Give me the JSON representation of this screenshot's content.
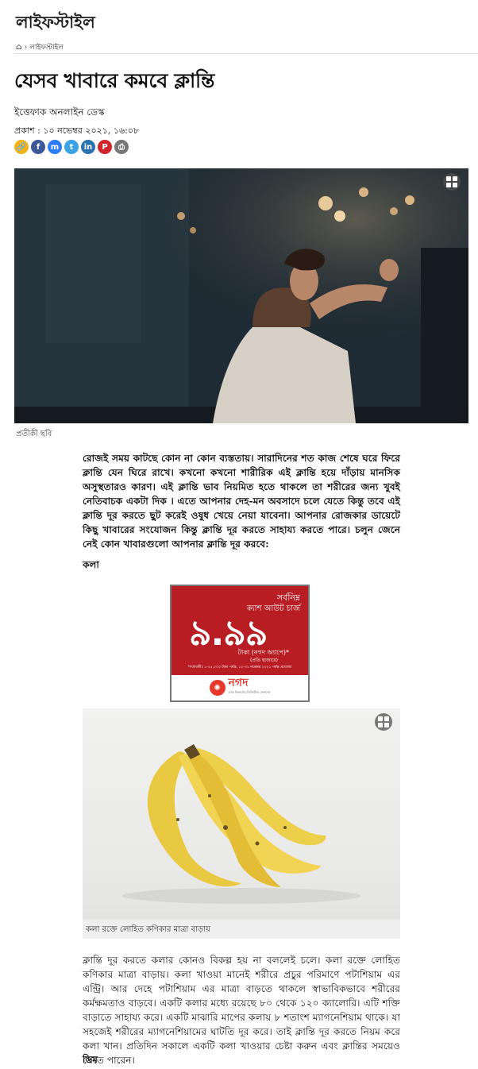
{
  "section": {
    "title": "লাইফস্টাইল"
  },
  "breadcrumb": {
    "home_icon": "home-icon",
    "separator": "›",
    "current": "লাইফস্টাইল"
  },
  "article": {
    "title": "যেসব খাবারে কমবে ক্লান্তি",
    "author": "ইত্তেফাক অনলাইন ডেস্ক",
    "published": "প্রকাশ : ১০ নভেম্বর ২০২১, ১৬:০৮",
    "share_buttons": [
      {
        "name": "copy-link-icon",
        "glyph": "🔗",
        "color": "#f2b31a"
      },
      {
        "name": "facebook-icon",
        "glyph": "f",
        "color": "#3b5998"
      },
      {
        "name": "messenger-icon",
        "glyph": "m",
        "color": "#2c7cf6"
      },
      {
        "name": "twitter-icon",
        "glyph": "t",
        "color": "#39a3e6"
      },
      {
        "name": "linkedin-icon",
        "glyph": "in",
        "color": "#2b73b0"
      },
      {
        "name": "pinterest-icon",
        "glyph": "P",
        "color": "#d1252b"
      },
      {
        "name": "print-icon",
        "glyph": "⎙",
        "color": "#777777"
      }
    ],
    "hero_caption": "প্রতীকী ছবি",
    "intro": "রোজই সময় কাটছে কোন না কোন ব্যস্ততায়। সারাদিনের শত কাজ শেষে ঘরে ফিরে ক্লান্তি যেন ঘিরে রাখে। কখনো কখনো শারীরিক এই ক্লান্তি হয়ে দাঁড়ায় মানসিক অসুস্থতারও কারণ। এই ক্লান্তি ভাব নিয়মিত হতে থাকলে তা শরীরের জন্য খুবই নেতিবাচক একটা দিক । এতে আপনার দেহ-মন অবসাদে চলে যেতে কিন্তু তবে এই ক্লান্তি দূর করতে ছুট করেই ওষুধ খেয়ে নেয়া যাবেনা। আপনার রোজকার ডায়েটে কিছু খাবারের সংযোজন কিন্তু ক্লান্তি দূর করতে সাহায্য করতে পারে। চলুন জেনে নেই কোন খাবারগুলো আপনার ক্লান্তি দূর করবে:",
    "subheading_1": "কলা",
    "banana_caption": "কলা রক্তে লোহিত কণিকার মাত্রা বাড়ায়",
    "banana_paragraph": "ক্লান্তি দূর করতে কলার কোনও বিকল্প হয় না বললেই চলে। কলা রক্তে লোহিত কণিকার মাত্রা বাড়ায়। কলা খাওয়া মানেই শরীরে প্রচুর পরিমাণে পটাশিয়াম এর এন্ট্রি। আর দেহে পটাশিয়াম এর মাত্রা বাড়তে থাকলে স্বাভাবিকভাবে শরীরের কর্মক্ষমতাও বাড়বে। একটি কলার মধ্যে রয়েছে ৮০ থেকে ১২০ ক্যালোরি। এটি শক্তি বাড়াতে সাহায্য করে। একটি মাঝারি মাপের কলায় ৮ শতাংশ ম্যাগনেশিয়াম থাকে। যা সহজেই শরীরের ম্যাগনেশিয়ামের ঘাটতি দূর করে। তাই ক্লান্তি দূর করতে নিয়ম করে কলা খান। প্রতিদিন সকালে একটি কলা খাওয়ার চেষ্টা করুন এবং ক্লান্তির সময়েও খেতে পারেন।",
    "subheading_2": "ডিম"
  },
  "ad": {
    "line1": "সর্বনিম্ন",
    "line2": "ক্যাশ আউট চার্জ",
    "amount": "৯.৯৯",
    "line3": "টাকা (নগদ অ্যাপে)*",
    "line4": "(প্রতি হাজারে)",
    "fine_print": "*শর্তাবলীঃ ১-২৫,০০০ টাকা পর্যন্ত, ১২-৩১ নভেম্বর ২০২১ পর্যন্ত প্রযোজ্য",
    "brand": "নগদ",
    "brand_tagline": "ডাক বিভাগের ডিজিটাল লেনদেন",
    "accent": "#b81d24"
  }
}
